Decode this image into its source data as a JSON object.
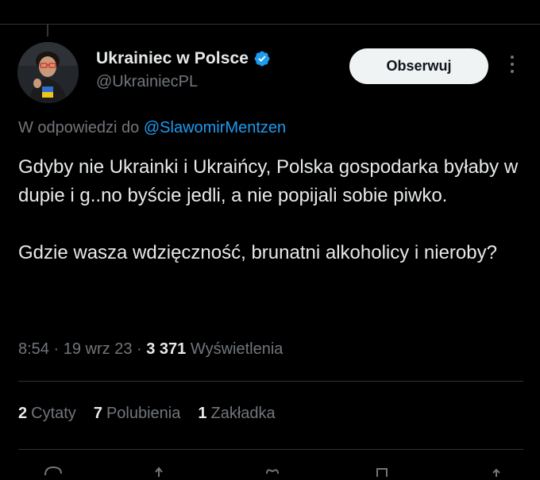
{
  "author": {
    "display_name": "Ukrainiec w Polsce",
    "handle": "@UkrainiecPL",
    "verified": true
  },
  "follow_label": "Obserwuj",
  "reply_to": {
    "prefix": "W odpowiedzi do",
    "mention": "@SlawomirMentzen"
  },
  "tweet": {
    "paragraph1": "Gdyby nie Ukrainki i Ukraińcy, Polska gospodarka byłaby w dupie i g..no byście jedli, a nie popijali sobie piwko.",
    "paragraph2": "Gdzie wasza wdzięczność, brunatni alkoholicy i nieroby?"
  },
  "meta": {
    "time": "8:54",
    "date": "19 wrz 23",
    "views_count": "3 371",
    "views_label": "Wyświetlenia"
  },
  "stats": {
    "quotes_count": "2",
    "quotes_label": "Cytaty",
    "likes_count": "7",
    "likes_label": "Polubienia",
    "bookmarks_count": "1",
    "bookmarks_label": "Zakładka"
  },
  "icons": {
    "verified": "verified-badge-icon",
    "more": "more-options-icon",
    "reply": "reply-icon",
    "repost": "repost-icon",
    "like": "heart-icon",
    "bookmark": "bookmark-icon",
    "share": "share-icon"
  },
  "colors": {
    "background": "#000000",
    "text_primary": "#e7e9ea",
    "text_secondary": "#71767b",
    "accent": "#1d9bf0",
    "follow_button_bg": "#eff3f4",
    "divider": "#2f3336"
  }
}
